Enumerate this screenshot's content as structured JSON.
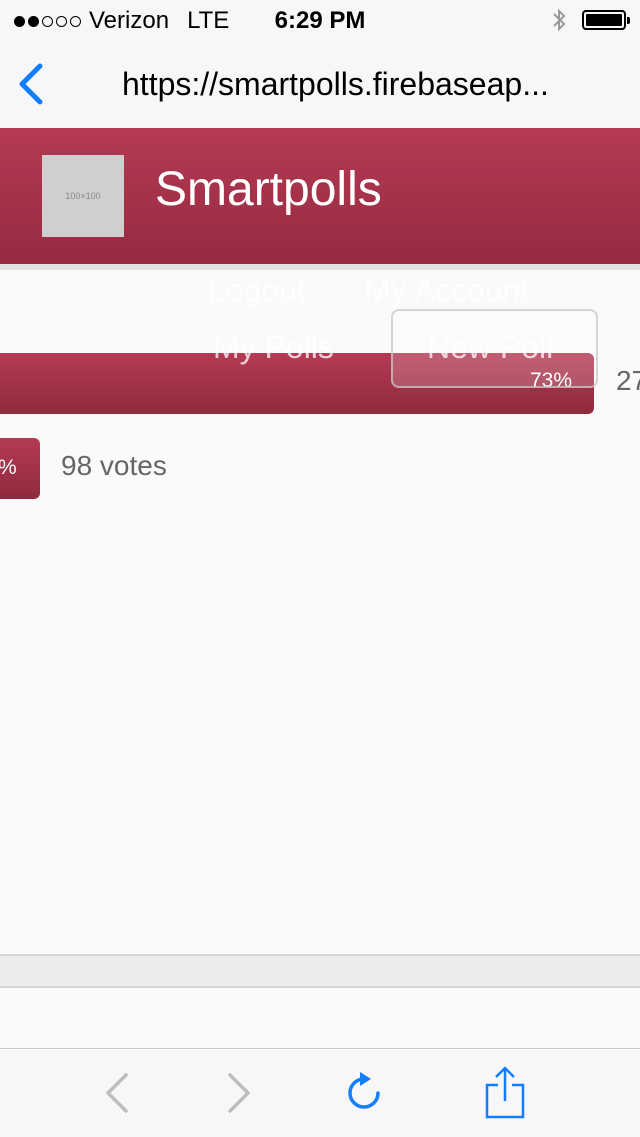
{
  "status_bar": {
    "carrier": "Verizon",
    "network": "LTE",
    "time": "6:29 PM",
    "signal_dots_filled": 2,
    "signal_dots_total": 5
  },
  "browser": {
    "url": "https://smartpolls.firebaseap..."
  },
  "header": {
    "logo_placeholder": "100×100",
    "site_title": "Smartpolls"
  },
  "nav": {
    "logout": "Logout",
    "my_account": "My Account",
    "my_polls": "My Polls",
    "new_poll": "New Poll"
  },
  "results": [
    {
      "percent_label": "73%",
      "votes_label": "27"
    },
    {
      "percent_label": "%",
      "votes_label": "98 votes"
    }
  ],
  "colors": {
    "brand": "#a83149",
    "ios_blue": "#157efb",
    "disabled_gray": "#bdbdbd"
  },
  "icons": {
    "back": "chevron-left-icon",
    "forward": "chevron-right-icon",
    "reload": "reload-icon",
    "share": "share-icon",
    "bluetooth": "bluetooth-icon",
    "battery": "battery-icon"
  }
}
